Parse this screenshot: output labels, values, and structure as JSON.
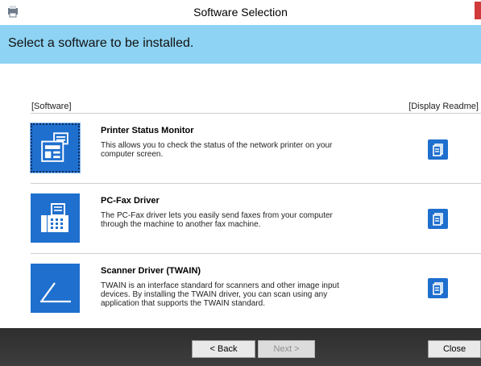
{
  "window": {
    "title": "Software Selection"
  },
  "header": {
    "text": "Select a software to be installed."
  },
  "columns": {
    "software": "[Software]",
    "readme": "[Display Readme]"
  },
  "software": [
    {
      "name": "Printer Status Monitor",
      "desc_lines": [
        "This allows you to check the status of the network printer on your",
        "computer screen."
      ],
      "icon": "printer-status-icon",
      "selected": true
    },
    {
      "name": "PC-Fax Driver",
      "desc_lines": [
        "The PC-Fax driver lets you easily send faxes from your computer",
        "through the machine to another fax machine."
      ],
      "icon": "fax-machine-icon",
      "selected": false
    },
    {
      "name": "Scanner Driver (TWAIN)",
      "desc_lines": [
        "TWAIN is an interface standard for scanners and other image input",
        "devices. By installing the TWAIN driver, you can scan using any",
        "application that supports the TWAIN standard."
      ],
      "icon": "scanner-icon",
      "selected": false
    }
  ],
  "buttons": {
    "back": {
      "label": "< Back",
      "enabled": true
    },
    "next": {
      "label": "Next >",
      "enabled": false
    },
    "close": {
      "label": "Close",
      "enabled": true
    }
  },
  "colors": {
    "header_bg": "#8ed3f3",
    "tile_bg": "#1f6fce",
    "footer_bg": "#333333"
  }
}
